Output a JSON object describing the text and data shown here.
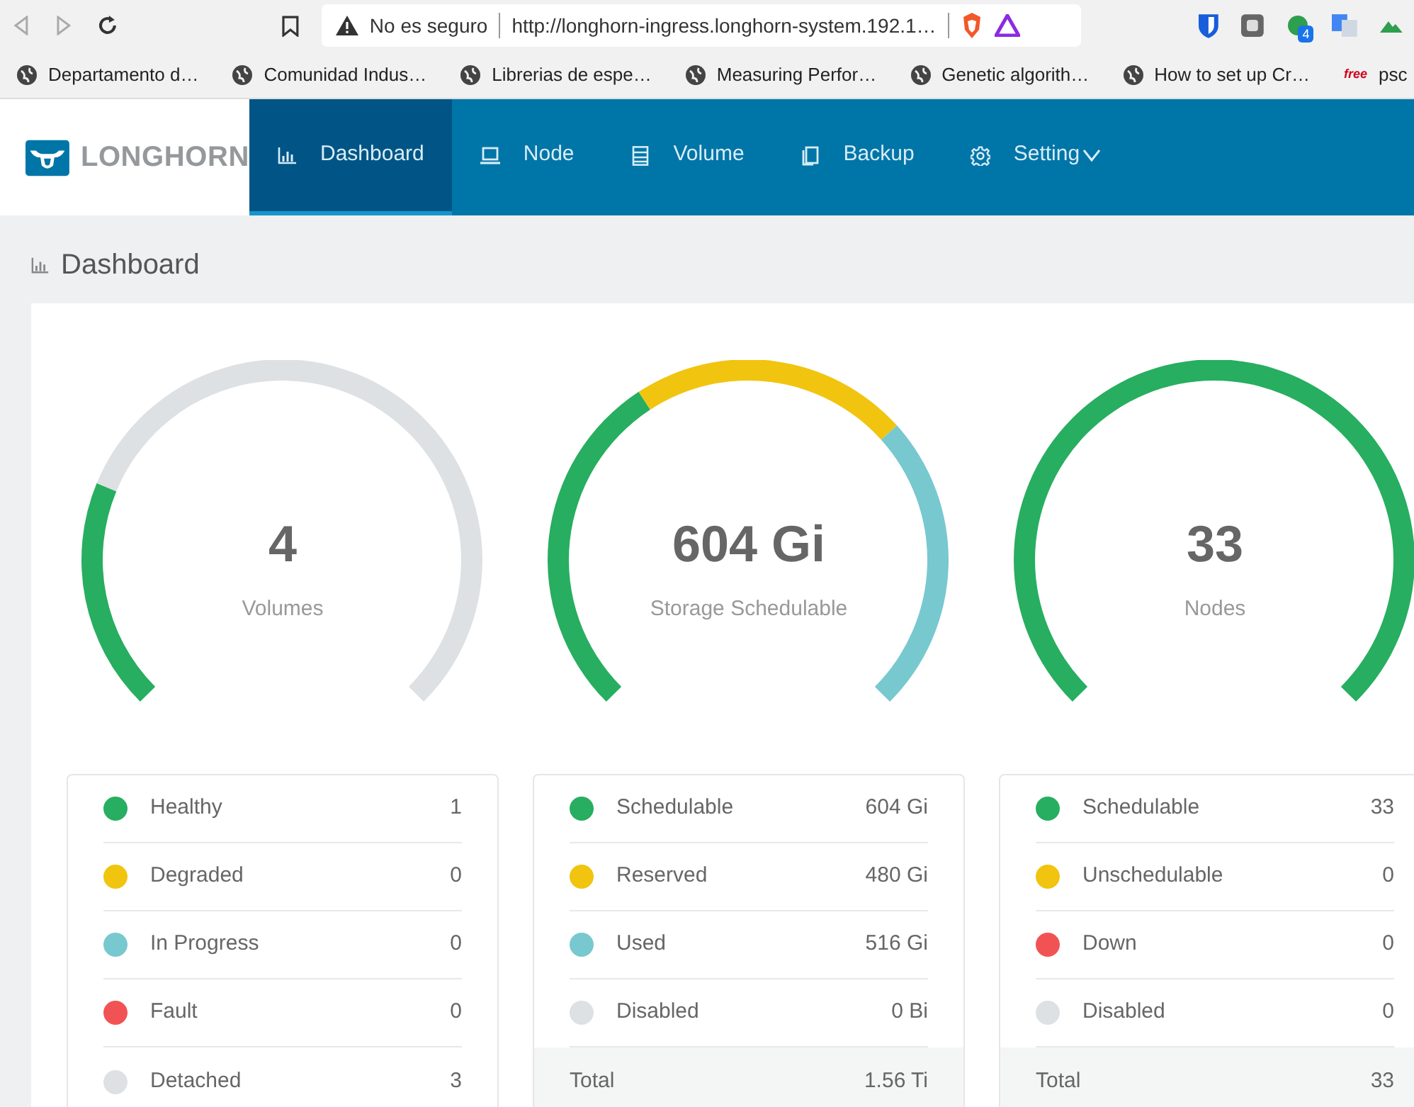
{
  "browser": {
    "security": "No es seguro",
    "url": "http://longhorn-ingress.longhorn-system.192.1…",
    "extension_badge": "4"
  },
  "bookmarks": [
    {
      "kind": "site",
      "label": "Departamento d…"
    },
    {
      "kind": "site",
      "label": "Comunidad Indus…"
    },
    {
      "kind": "site",
      "label": "Librerias de espe…"
    },
    {
      "kind": "site",
      "label": "Measuring Perfor…"
    },
    {
      "kind": "site",
      "label": "Genetic algorith…"
    },
    {
      "kind": "site",
      "label": "How to set up Cr…"
    },
    {
      "kind": "free",
      "icon_text": "free",
      "label": "psc"
    }
  ],
  "app": {
    "logo": "LONGHORN",
    "nav": [
      {
        "label": "Dashboard",
        "selected": true,
        "dropdown": false
      },
      {
        "label": "Node",
        "selected": false,
        "dropdown": false
      },
      {
        "label": "Volume",
        "selected": false,
        "dropdown": false
      },
      {
        "label": "Backup",
        "selected": false,
        "dropdown": false
      },
      {
        "label": "Setting",
        "selected": false,
        "dropdown": true
      }
    ]
  },
  "page_title": "Dashboard",
  "panels": [
    {
      "value": "4",
      "label": "Volumes",
      "legend": [
        {
          "label": "Healthy",
          "count": "1",
          "color": "#27ae60"
        },
        {
          "label": "Degraded",
          "count": "0",
          "color": "#f1c40f"
        },
        {
          "label": "In Progress",
          "count": "0",
          "color": "#78c8cf"
        },
        {
          "label": "Fault",
          "count": "0",
          "color": "#f15354"
        },
        {
          "label": "Detached",
          "count": "3",
          "color": "#dee1e3"
        }
      ]
    },
    {
      "value": "604 Gi",
      "label": "Storage Schedulable",
      "legend": [
        {
          "label": "Schedulable",
          "count": "604 Gi",
          "color": "#27ae60"
        },
        {
          "label": "Reserved",
          "count": "480 Gi",
          "color": "#f1c40f"
        },
        {
          "label": "Used",
          "count": "516 Gi",
          "color": "#78c8cf"
        },
        {
          "label": "Disabled",
          "count": "0 Bi",
          "color": "#dee1e3"
        }
      ],
      "total": {
        "label": "Total",
        "value": "1.56 Ti"
      }
    },
    {
      "value": "33",
      "label": "Nodes",
      "legend": [
        {
          "label": "Schedulable",
          "count": "33",
          "color": "#27ae60"
        },
        {
          "label": "Unschedulable",
          "count": "0",
          "color": "#f1c40f"
        },
        {
          "label": "Down",
          "count": "0",
          "color": "#f15354"
        },
        {
          "label": "Disabled",
          "count": "0",
          "color": "#dee1e3"
        }
      ],
      "total": {
        "label": "Total",
        "value": "33"
      }
    }
  ]
}
